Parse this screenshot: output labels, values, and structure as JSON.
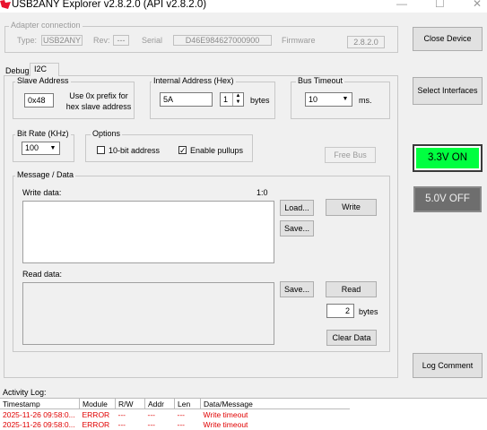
{
  "window": {
    "title": "USB2ANY Explorer v2.8.2.0  (API v2.8.2.0)",
    "controls": [
      "minimize-icon",
      "maximize-icon",
      "close-icon"
    ]
  },
  "adapter": {
    "group_label": "Adapter connection",
    "type_label": "Type:",
    "type_value": "USB2ANY",
    "rev_label": "Rev:",
    "rev_value": "---",
    "serial_label": "Serial",
    "serial_value": "D46E984627000900",
    "firmware_label": "Firmware",
    "firmware_value": "2.8.2.0"
  },
  "right_panel": {
    "close_device": "Close Device",
    "select_interfaces": "Select Interfaces",
    "v33": "3.3V ON",
    "v50": "5.0V OFF",
    "log_comment": "Log Comment",
    "colors": {
      "v33_bg": "#00ff40",
      "v50_bg": "#6e6e6e"
    }
  },
  "tabs": [
    {
      "label": "Debug"
    },
    {
      "label": "I2C"
    }
  ],
  "i2c": {
    "slave": {
      "group_label": "Slave Address",
      "value": "0x48",
      "hint": "Use 0x prefix for hex slave address"
    },
    "internal": {
      "group_label": "Internal Address (Hex)",
      "value": "5A",
      "width_value": "1",
      "unit": "bytes"
    },
    "timeout": {
      "group_label": "Bus Timeout",
      "value": "10",
      "unit": "ms."
    },
    "bitrate": {
      "group_label": "Bit Rate (KHz)",
      "value": "100"
    },
    "options": {
      "group_label": "Options",
      "ten_bit": {
        "label": "10-bit address",
        "checked": false
      },
      "pullups": {
        "label": "Enable pullups",
        "checked": true
      }
    },
    "free_bus": "Free Bus",
    "message": {
      "group_label": "Message / Data",
      "write_label": "Write data:",
      "write_count": "1:0",
      "load": "Load...",
      "write_save": "Save...",
      "write": "Write",
      "read_label": "Read data:",
      "read_save": "Save...",
      "read": "Read",
      "read_bytes_value": "2",
      "read_bytes_unit": "bytes",
      "clear": "Clear Data"
    }
  },
  "activity_log": {
    "label": "Activity Log:",
    "columns": [
      "Timestamp",
      "Module",
      "R/W",
      "Addr",
      "Len",
      "Data/Message"
    ],
    "rows": [
      [
        "2025-11-26 09:58:0...",
        "ERROR",
        "---",
        "---",
        "---",
        "Write timeout"
      ],
      [
        "2025-11-26 09:58:0...",
        "ERROR",
        "---",
        "---",
        "---",
        "Write timeout"
      ]
    ]
  }
}
